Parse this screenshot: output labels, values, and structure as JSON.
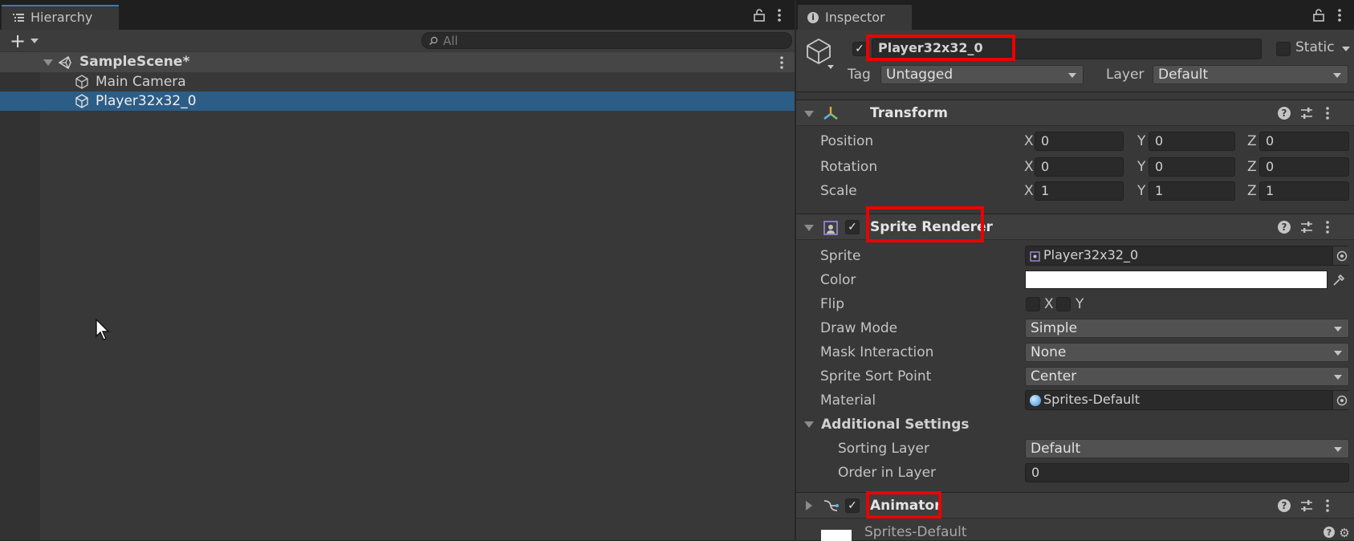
{
  "hierarchy": {
    "tab_label": "Hierarchy",
    "search_placeholder": "All",
    "scene": "SampleScene*",
    "items": [
      {
        "label": "Main Camera"
      },
      {
        "label": "Player32x32_0"
      }
    ]
  },
  "inspector": {
    "tab_label": "Inspector",
    "object_name": "Player32x32_0",
    "static_label": "Static",
    "tag_label": "Tag",
    "tag_value": "Untagged",
    "layer_label": "Layer",
    "layer_value": "Default",
    "transform": {
      "title": "Transform",
      "rows": [
        {
          "label": "Position",
          "x": "0",
          "y": "0",
          "z": "0"
        },
        {
          "label": "Rotation",
          "x": "0",
          "y": "0",
          "z": "0"
        },
        {
          "label": "Scale",
          "x": "1",
          "y": "1",
          "z": "1"
        }
      ],
      "axis_x": "X",
      "axis_y": "Y",
      "axis_z": "Z"
    },
    "sprite_renderer": {
      "title": "Sprite Renderer",
      "sprite_label": "Sprite",
      "sprite_value": "Player32x32_0",
      "color_label": "Color",
      "color_value": "#ffffff",
      "flip_label": "Flip",
      "flip_x": "X",
      "flip_y": "Y",
      "draw_mode_label": "Draw Mode",
      "draw_mode_value": "Simple",
      "mask_label": "Mask Interaction",
      "mask_value": "None",
      "sort_point_label": "Sprite Sort Point",
      "sort_point_value": "Center",
      "material_label": "Material",
      "material_value": "Sprites-Default",
      "additional_title": "Additional Settings",
      "sorting_layer_label": "Sorting Layer",
      "sorting_layer_value": "Default",
      "order_label": "Order in Layer",
      "order_value": "0"
    },
    "animator": {
      "title": "Animator"
    },
    "material_preview": {
      "title": "Sprites-Default"
    }
  },
  "colors": {
    "selection": "#2c5d87",
    "highlight_box": "#ec0000",
    "accent_tab": "#3a79bb"
  }
}
